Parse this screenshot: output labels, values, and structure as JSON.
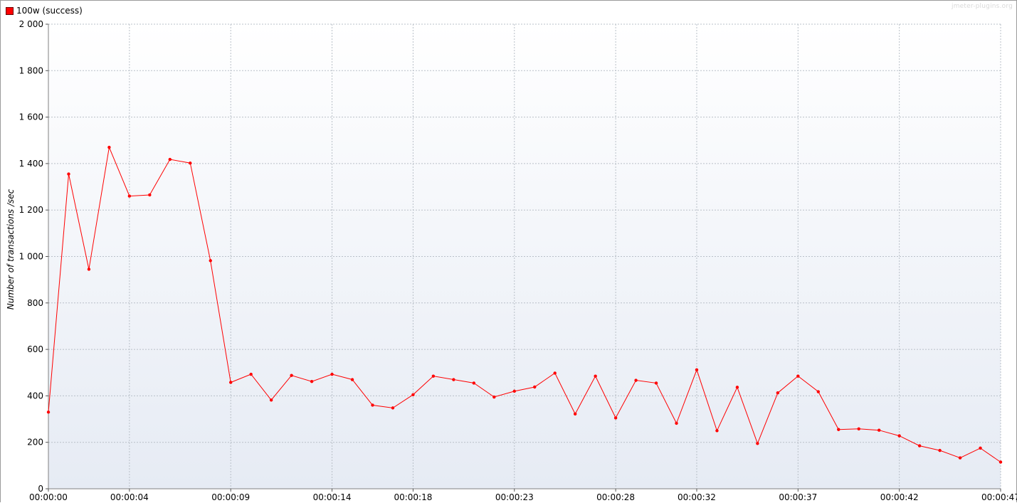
{
  "legend": {
    "label": "100w (success)",
    "color": "#ff0000"
  },
  "watermark": "jmeter-plugins.org",
  "chart_data": {
    "type": "line",
    "title": "",
    "xlabel": "",
    "ylabel": "Number of transactions /sec",
    "ylim": [
      0,
      2000
    ],
    "y_ticks": [
      0,
      200,
      400,
      600,
      800,
      1000,
      1200,
      1400,
      1600,
      1800,
      2000
    ],
    "y_tick_labels": [
      "0",
      "200",
      "400",
      "600",
      "800",
      "1 000",
      "1 200",
      "1 400",
      "1 600",
      "1 800",
      "2 000"
    ],
    "xlim": [
      "00:00:00",
      "00:00:47"
    ],
    "x_ticks": [
      "00:00:00",
      "00:00:04",
      "00:00:09",
      "00:00:14",
      "00:00:18",
      "00:00:23",
      "00:00:28",
      "00:00:32",
      "00:00:37",
      "00:00:42",
      "00:00:47"
    ],
    "grid": true,
    "legend_position": "top-left",
    "series": [
      {
        "name": "100w (success)",
        "color": "#ff0000",
        "x": [
          "00:00:00",
          "00:00:01",
          "00:00:02",
          "00:00:03",
          "00:00:04",
          "00:00:05",
          "00:00:06",
          "00:00:07",
          "00:00:08",
          "00:00:09",
          "00:00:10",
          "00:00:11",
          "00:00:12",
          "00:00:13",
          "00:00:14",
          "00:00:15",
          "00:00:16",
          "00:00:17",
          "00:00:18",
          "00:00:19",
          "00:00:20",
          "00:00:21",
          "00:00:22",
          "00:00:23",
          "00:00:24",
          "00:00:25",
          "00:00:26",
          "00:00:27",
          "00:00:28",
          "00:00:29",
          "00:00:30",
          "00:00:31",
          "00:00:32",
          "00:00:33",
          "00:00:34",
          "00:00:35",
          "00:00:36",
          "00:00:37",
          "00:00:38",
          "00:00:39",
          "00:00:40",
          "00:00:41",
          "00:00:42",
          "00:00:43",
          "00:00:44",
          "00:00:45",
          "00:00:46",
          "00:00:47"
        ],
        "values": [
          330,
          1355,
          945,
          1470,
          1260,
          1265,
          1418,
          1402,
          982,
          458,
          493,
          382,
          488,
          462,
          493,
          470,
          360,
          348,
          405,
          485,
          470,
          455,
          395,
          420,
          438,
          498,
          322,
          485,
          305,
          467,
          455,
          282,
          512,
          250,
          437,
          195,
          413,
          485,
          418,
          255,
          258,
          252,
          228,
          185,
          165,
          133,
          175,
          115
        ]
      }
    ]
  }
}
